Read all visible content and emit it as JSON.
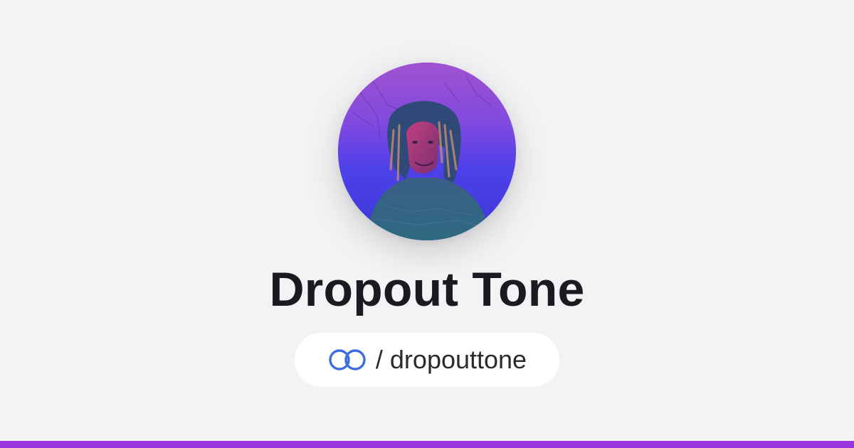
{
  "profile": {
    "name": "Dropout Tone",
    "handle": "/ dropouttone",
    "avatar_description_icon": "profile-photo",
    "link_icon": "linked-rings-icon"
  },
  "colors": {
    "background": "#f3f3f5",
    "name_text": "#1b1b1f",
    "pill_background": "#ffffff",
    "link_icon": "#3b6fe0",
    "bottom_bar": "#9a33e0",
    "avatar_gradient_top": "#9a4fd6",
    "avatar_gradient_bottom": "#3b36d8"
  }
}
